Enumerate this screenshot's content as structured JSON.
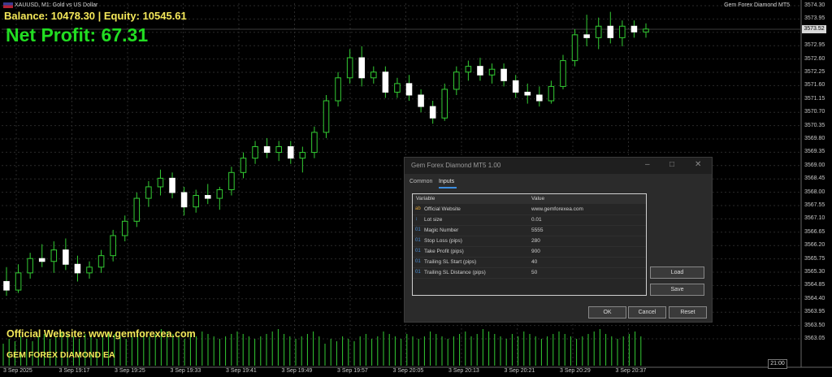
{
  "chart_header": {
    "symbol": "XAUUSD, M1:  Gold vs US Dollar",
    "ea_name": "Gem Forex Diamond MT5"
  },
  "overlay": {
    "balance_line": "Balance: 10478.30 | Equity: 10545.61",
    "net_profit": "Net Profit: 67.31",
    "website_line": "Official Website: www.gemforexea.com",
    "ea_title_line": "GEM FOREX DIAMOND EA"
  },
  "price_axis": {
    "labels": [
      "3574.30",
      "3573.95",
      "3573.25",
      "3572.95",
      "3572.60",
      "3572.25",
      "3571.60",
      "3571.15",
      "3570.70",
      "3570.35",
      "3569.80",
      "3569.35",
      "3569.00",
      "3568.45",
      "3568.00",
      "3567.55",
      "3567.10",
      "3566.65",
      "3566.20",
      "3565.75",
      "3565.30",
      "3564.85",
      "3564.40",
      "3563.95",
      "3563.50",
      "3563.05"
    ],
    "current_price": "3573.52"
  },
  "time_axis": {
    "labels": [
      "3 Sep 2025",
      "3 Sep 19:17",
      "3 Sep 19:25",
      "3 Sep 19:33",
      "3 Sep 19:41",
      "3 Sep 19:49",
      "3 Sep 19:57",
      "3 Sep 20:05",
      "3 Sep 20:13",
      "3 Sep 20:21",
      "3 Sep 20:29",
      "3 Sep 20:37"
    ],
    "period_box": "21:00"
  },
  "colors": {
    "candle_up": "#000000",
    "candle_down": "#ffffff",
    "wick": "#33cc33",
    "grid": "#2a2a2a",
    "volume": "#33cc33",
    "accent_tab": "#3d8ee0"
  },
  "dialog": {
    "title": "Gem Forex Diamond MT5 1.00",
    "tabs": [
      "Common",
      "Inputs"
    ],
    "active_tab": "Inputs",
    "columns": [
      "Variable",
      "Value"
    ],
    "rows": [
      {
        "icon": "ab",
        "variable": "Official Website",
        "value": "www.gemforexea.com"
      },
      {
        "icon": "lot-size-icon",
        "variable": "Lot size",
        "value": "0.01"
      },
      {
        "icon": "01",
        "variable": "Magic Number",
        "value": "5555"
      },
      {
        "icon": "01",
        "variable": "Stop Loss (pips)",
        "value": "280"
      },
      {
        "icon": "01",
        "variable": "Take Profit (pips)",
        "value": "900"
      },
      {
        "icon": "01",
        "variable": "Trailing SL Start (pips)",
        "value": "40"
      },
      {
        "icon": "01",
        "variable": "Trailing SL Distance (pips)",
        "value": "50"
      }
    ],
    "buttons": {
      "load": "Load",
      "save": "Save",
      "ok": "OK",
      "cancel": "Cancel",
      "reset": "Reset"
    }
  },
  "chart_data": {
    "type": "candlestick",
    "series": [
      {
        "o": 3564.7,
        "h": 3565.2,
        "l": 3564.2,
        "c": 3564.4
      },
      {
        "o": 3564.4,
        "h": 3565.3,
        "l": 3564.3,
        "c": 3565.0
      },
      {
        "o": 3565.0,
        "h": 3565.7,
        "l": 3564.8,
        "c": 3565.5
      },
      {
        "o": 3565.5,
        "h": 3566.0,
        "l": 3565.2,
        "c": 3565.4
      },
      {
        "o": 3565.4,
        "h": 3566.1,
        "l": 3565.0,
        "c": 3565.8
      },
      {
        "o": 3565.8,
        "h": 3566.2,
        "l": 3565.1,
        "c": 3565.3
      },
      {
        "o": 3565.3,
        "h": 3565.6,
        "l": 3564.7,
        "c": 3565.0
      },
      {
        "o": 3565.0,
        "h": 3565.4,
        "l": 3564.8,
        "c": 3565.2
      },
      {
        "o": 3565.2,
        "h": 3565.8,
        "l": 3565.0,
        "c": 3565.6
      },
      {
        "o": 3565.6,
        "h": 3566.5,
        "l": 3565.4,
        "c": 3566.3
      },
      {
        "o": 3566.3,
        "h": 3567.0,
        "l": 3566.1,
        "c": 3566.8
      },
      {
        "o": 3566.8,
        "h": 3567.8,
        "l": 3566.6,
        "c": 3567.6
      },
      {
        "o": 3567.6,
        "h": 3568.2,
        "l": 3567.3,
        "c": 3568.0
      },
      {
        "o": 3568.0,
        "h": 3568.6,
        "l": 3567.7,
        "c": 3568.3
      },
      {
        "o": 3568.3,
        "h": 3568.5,
        "l": 3567.6,
        "c": 3567.8
      },
      {
        "o": 3567.8,
        "h": 3568.0,
        "l": 3567.0,
        "c": 3567.3
      },
      {
        "o": 3567.3,
        "h": 3567.9,
        "l": 3567.1,
        "c": 3567.7
      },
      {
        "o": 3567.7,
        "h": 3568.1,
        "l": 3567.4,
        "c": 3567.6
      },
      {
        "o": 3567.6,
        "h": 3568.0,
        "l": 3567.2,
        "c": 3567.9
      },
      {
        "o": 3567.9,
        "h": 3568.7,
        "l": 3567.7,
        "c": 3568.5
      },
      {
        "o": 3568.5,
        "h": 3569.2,
        "l": 3568.3,
        "c": 3569.0
      },
      {
        "o": 3569.0,
        "h": 3569.6,
        "l": 3568.8,
        "c": 3569.4
      },
      {
        "o": 3569.4,
        "h": 3569.7,
        "l": 3569.0,
        "c": 3569.2
      },
      {
        "o": 3569.2,
        "h": 3569.6,
        "l": 3568.9,
        "c": 3569.4
      },
      {
        "o": 3569.4,
        "h": 3569.6,
        "l": 3568.8,
        "c": 3569.0
      },
      {
        "o": 3569.0,
        "h": 3569.4,
        "l": 3568.5,
        "c": 3569.2
      },
      {
        "o": 3569.2,
        "h": 3570.1,
        "l": 3569.0,
        "c": 3569.9
      },
      {
        "o": 3569.9,
        "h": 3571.2,
        "l": 3569.7,
        "c": 3571.0
      },
      {
        "o": 3571.0,
        "h": 3572.0,
        "l": 3570.8,
        "c": 3571.8
      },
      {
        "o": 3571.8,
        "h": 3572.8,
        "l": 3571.6,
        "c": 3572.5
      },
      {
        "o": 3572.5,
        "h": 3572.9,
        "l": 3571.5,
        "c": 3571.8
      },
      {
        "o": 3571.8,
        "h": 3572.2,
        "l": 3571.6,
        "c": 3572.0
      },
      {
        "o": 3572.0,
        "h": 3572.2,
        "l": 3571.1,
        "c": 3571.3
      },
      {
        "o": 3571.3,
        "h": 3571.8,
        "l": 3571.1,
        "c": 3571.6
      },
      {
        "o": 3571.6,
        "h": 3571.9,
        "l": 3571.0,
        "c": 3571.2
      },
      {
        "o": 3571.2,
        "h": 3571.4,
        "l": 3570.6,
        "c": 3570.8
      },
      {
        "o": 3570.8,
        "h": 3571.0,
        "l": 3570.2,
        "c": 3570.4
      },
      {
        "o": 3570.4,
        "h": 3571.6,
        "l": 3570.3,
        "c": 3571.4
      },
      {
        "o": 3571.4,
        "h": 3572.2,
        "l": 3571.2,
        "c": 3572.0
      },
      {
        "o": 3572.0,
        "h": 3572.4,
        "l": 3571.7,
        "c": 3572.2
      },
      {
        "o": 3572.2,
        "h": 3572.5,
        "l": 3571.7,
        "c": 3571.9
      },
      {
        "o": 3571.9,
        "h": 3572.3,
        "l": 3571.6,
        "c": 3572.1
      },
      {
        "o": 3572.1,
        "h": 3572.3,
        "l": 3571.5,
        "c": 3571.7
      },
      {
        "o": 3571.7,
        "h": 3571.9,
        "l": 3571.1,
        "c": 3571.3
      },
      {
        "o": 3571.3,
        "h": 3571.6,
        "l": 3570.9,
        "c": 3571.2
      },
      {
        "o": 3571.2,
        "h": 3571.5,
        "l": 3570.8,
        "c": 3571.0
      },
      {
        "o": 3571.0,
        "h": 3571.7,
        "l": 3570.9,
        "c": 3571.5
      },
      {
        "o": 3571.5,
        "h": 3572.6,
        "l": 3571.4,
        "c": 3572.4
      },
      {
        "o": 3572.4,
        "h": 3573.5,
        "l": 3572.2,
        "c": 3573.3
      },
      {
        "o": 3573.3,
        "h": 3574.0,
        "l": 3572.9,
        "c": 3573.2
      },
      {
        "o": 3573.2,
        "h": 3573.9,
        "l": 3572.8,
        "c": 3573.6
      },
      {
        "o": 3573.6,
        "h": 3574.1,
        "l": 3573.0,
        "c": 3573.2
      },
      {
        "o": 3573.2,
        "h": 3573.8,
        "l": 3572.9,
        "c": 3573.6
      },
      {
        "o": 3573.6,
        "h": 3573.8,
        "l": 3573.2,
        "c": 3573.4
      },
      {
        "o": 3573.4,
        "h": 3573.7,
        "l": 3573.2,
        "c": 3573.5
      }
    ],
    "volume": [
      3,
      5,
      4,
      6,
      5,
      4,
      6,
      7,
      5,
      6,
      8,
      7,
      6,
      5,
      7,
      6,
      5,
      6,
      8,
      7,
      6,
      5,
      6,
      7,
      8,
      6,
      7,
      9,
      8,
      7,
      6,
      5,
      7,
      6,
      8,
      7,
      6,
      5,
      6,
      7,
      8,
      7,
      6,
      5,
      6,
      7,
      8,
      9,
      7,
      6,
      5,
      6,
      7,
      8,
      6
    ],
    "y_range": [
      3562.9,
      3574.4
    ]
  }
}
